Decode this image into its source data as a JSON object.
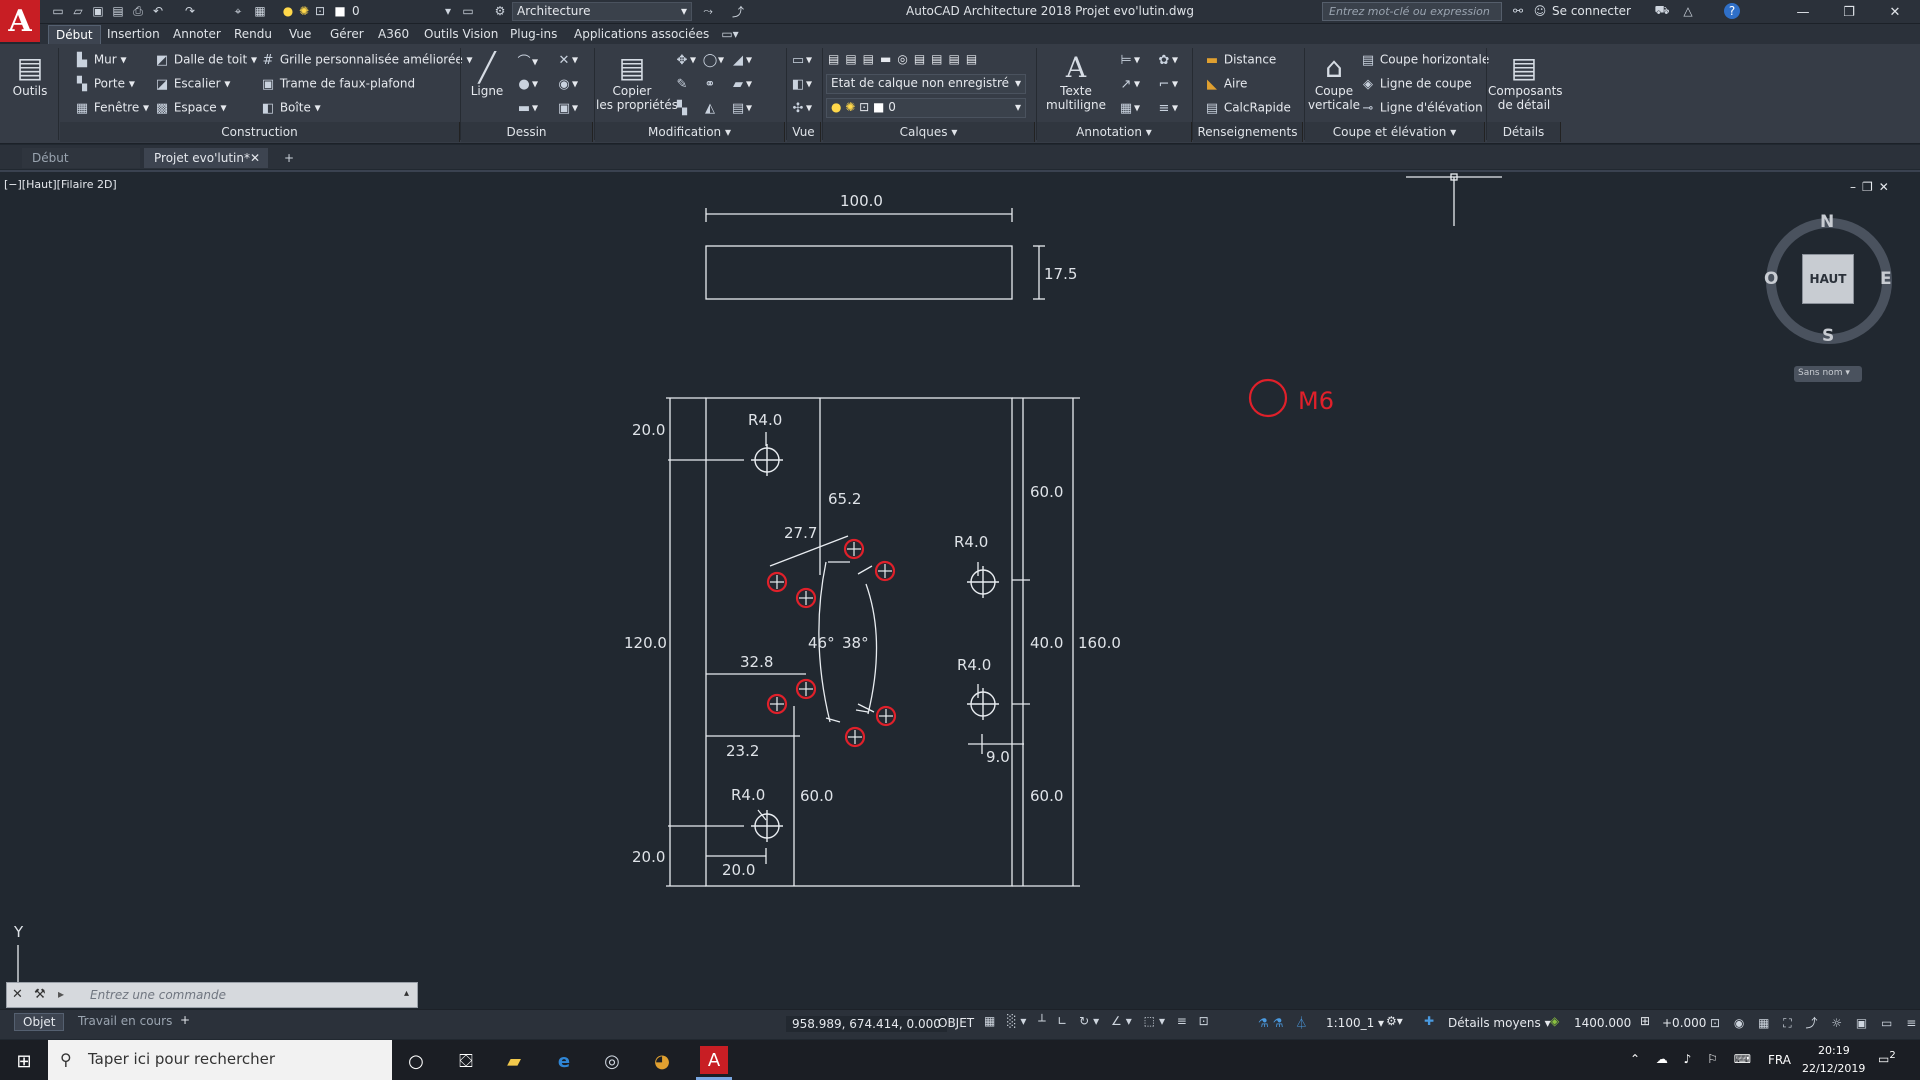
{
  "app": {
    "title": "AutoCAD Architecture 2018   Projet evo'lutin.dwg",
    "logo_letter": "A",
    "layer_value": "0",
    "workspace": "Architecture",
    "search_placeholder": "Entrez mot-clé ou expression",
    "signin": "Se connecter"
  },
  "menu": [
    "Début",
    "Insertion",
    "Annoter",
    "Rendu",
    "Vue",
    "Gérer",
    "A360",
    "Outils Vision",
    "Plug-ins",
    "Applications associées"
  ],
  "ribbon": {
    "outils": "Outils",
    "construction": {
      "mur": "Mur",
      "porte": "Porte",
      "fenetre": "Fenêtre",
      "dalle": "Dalle de toit",
      "escalier": "Escalier",
      "espace": "Espace",
      "grille": "Grille personnalisée améliorée",
      "trame": "Trame de faux-plafond",
      "boite": "Boîte",
      "label": "Construction"
    },
    "dessin": {
      "ligne": "Ligne",
      "label": "Dessin"
    },
    "modification": {
      "copier1": "Copier",
      "copier2": "les propriétés",
      "label": "Modification"
    },
    "vue": {
      "label": "Vue"
    },
    "calques": {
      "state": "Etat de calque non enregistré",
      "layer": "0",
      "label": "Calques"
    },
    "annotation": {
      "texte1": "Texte",
      "texte2": "multiligne",
      "label": "Annotation"
    },
    "renseignements": {
      "distance": "Distance",
      "aire": "Aire",
      "calc": "CalcRapide",
      "label": "Renseignements"
    },
    "coupe": {
      "coupev1": "Coupe",
      "coupev2": "verticale",
      "horiz": "Coupe horizontale",
      "ligne": "Ligne de coupe",
      "elev": "Ligne d'élévation",
      "label": "Coupe et élévation"
    },
    "details": {
      "comp1": "Composants",
      "comp2": "de détail",
      "label": "Détails"
    }
  },
  "doctabs": {
    "start": "Début",
    "active": "Projet evo'lutin*",
    "add": "+"
  },
  "viewport": {
    "label": "[−][Haut][Filaire 2D]",
    "compass": {
      "n": "N",
      "s": "S",
      "e": "E",
      "w": "O",
      "center": "HAUT",
      "ucs": "Sans nom"
    },
    "y_axis": "Y"
  },
  "drawing": {
    "top_width": "100.0",
    "top_height": "17.5",
    "m6": "M6",
    "dims": {
      "d20a": "20.0",
      "r1": "R4.0",
      "d652": "65.2",
      "d277": "27.7",
      "r2": "R4.0",
      "d600a": "60.0",
      "d1200": "120.0",
      "d46": "46°",
      "d38": "38°",
      "d400": "40.0",
      "d1600": "160.0",
      "d328": "32.8",
      "r3": "R4.0",
      "d232": "23.2",
      "d90": "9.0",
      "r4": "R4.0",
      "d600b": "60.0",
      "d600c": "60.0",
      "d20b": "20.0",
      "d20c": "20.0"
    }
  },
  "command": {
    "placeholder": "Entrez une commande"
  },
  "layout_tabs": [
    "Objet",
    "Travail en cours",
    "+"
  ],
  "status": {
    "coords": "958.989, 674.414, 0.000",
    "mode": "OBJET",
    "scale": "1:100_1",
    "detail": "Détails moyens",
    "elev": "1400.000",
    "offset": "+0.000"
  },
  "taskbar": {
    "search": "Taper ici pour rechercher",
    "lang": "FRA",
    "time": "20:19",
    "date": "22/12/2019",
    "notif": "2"
  },
  "colors": {
    "bg": "#212830",
    "accent": "#c81e24",
    "marker": "#e0202a"
  }
}
